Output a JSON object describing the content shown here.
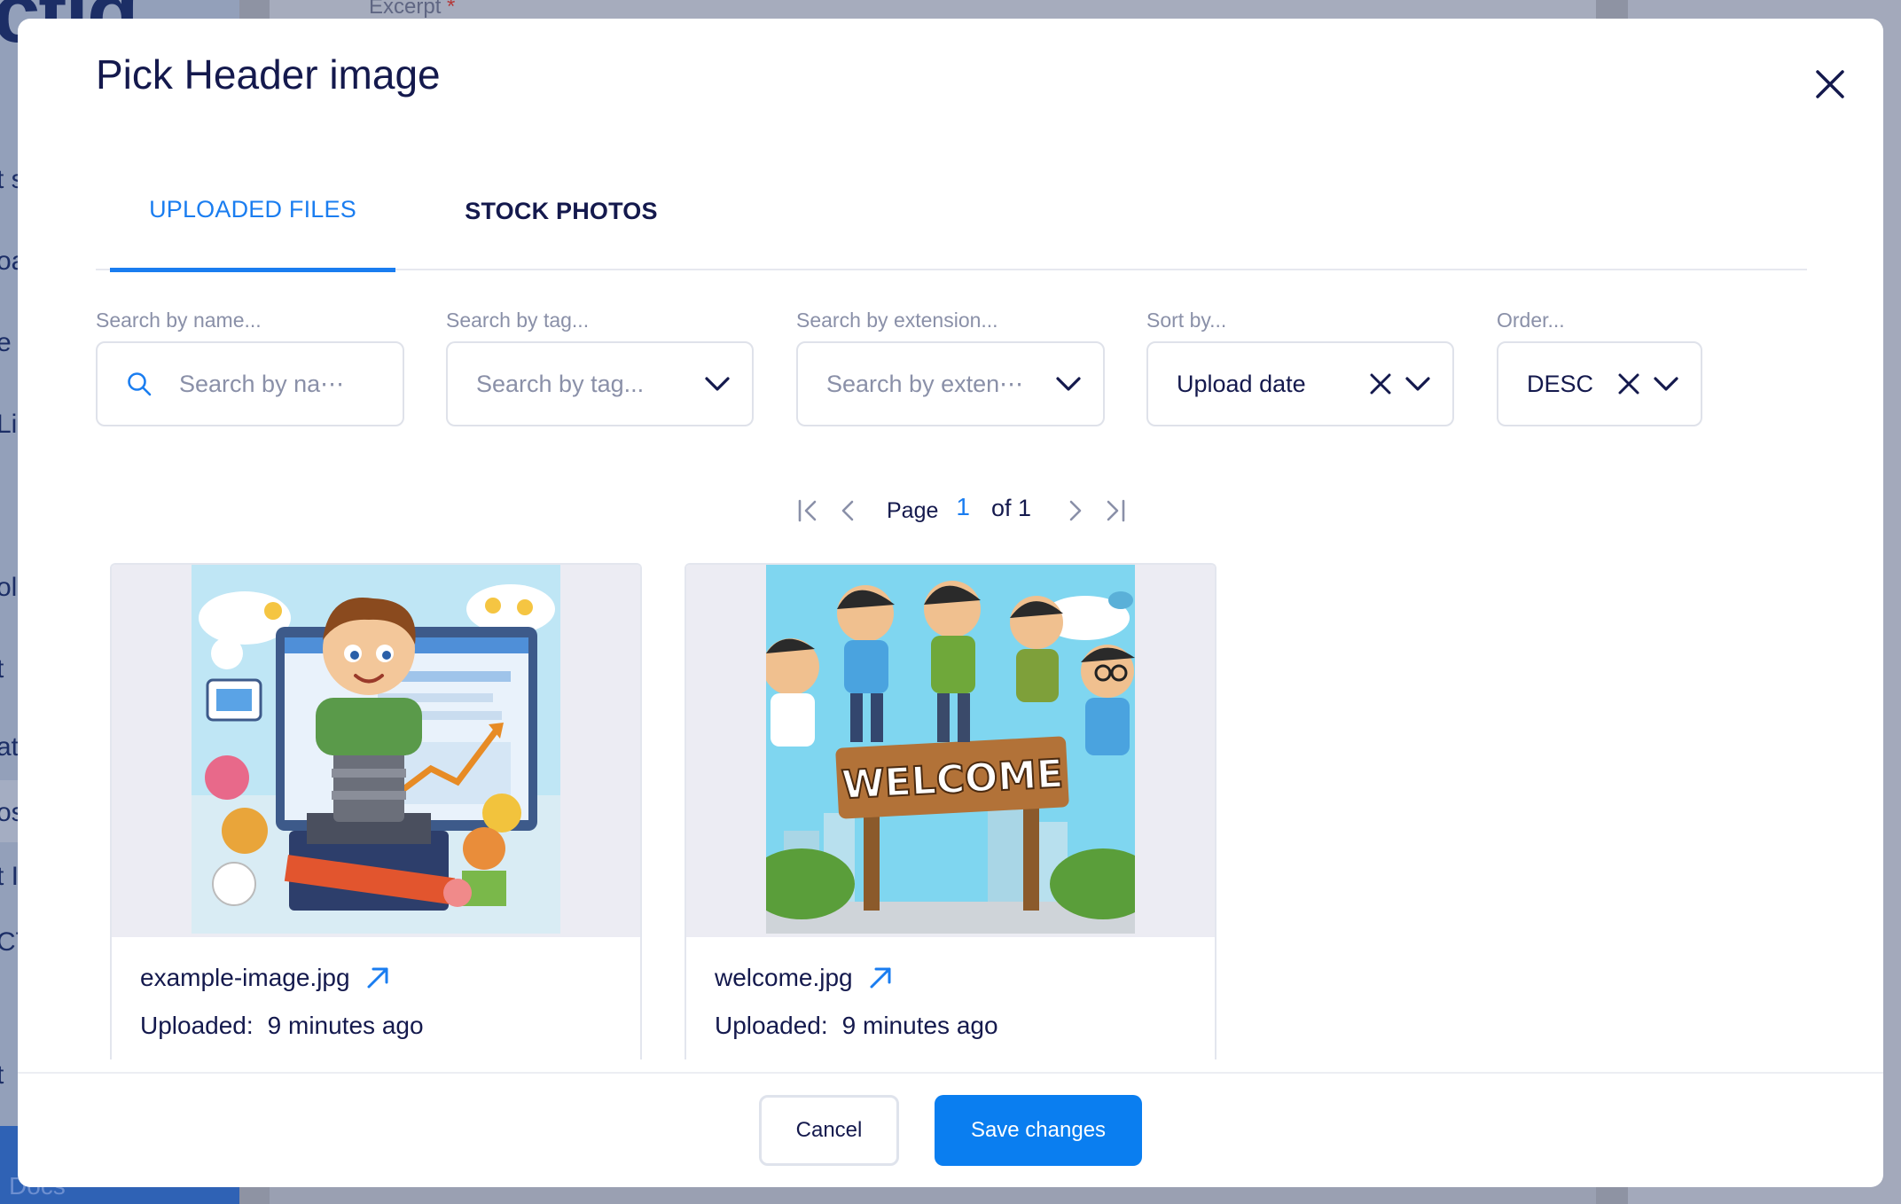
{
  "background": {
    "brand": "ctiq",
    "excerpt_label": "Excerpt",
    "required_mark": "*",
    "sidebar_fragments": [
      "t s",
      "oa",
      "e",
      "Li",
      "ole",
      "t",
      "ate",
      "os",
      "t I",
      "CT",
      "t"
    ],
    "docs_label": "Docs"
  },
  "modal": {
    "title": "Pick Header image",
    "tabs": [
      {
        "label": "UPLOADED FILES",
        "active": true
      },
      {
        "label": "STOCK PHOTOS",
        "active": false
      }
    ],
    "filters": {
      "name": {
        "label": "Search by name...",
        "placeholder": "Search by na⋯"
      },
      "tag": {
        "label": "Search by tag...",
        "placeholder": "Search by tag..."
      },
      "extension": {
        "label": "Search by extension...",
        "placeholder": "Search by exten⋯"
      },
      "sort": {
        "label": "Sort by...",
        "value": "Upload date"
      },
      "order": {
        "label": "Order...",
        "value": "DESC"
      }
    },
    "pagination": {
      "page_label": "Page",
      "current": "1",
      "of_label": "of 1"
    },
    "files": [
      {
        "name": "example-image.jpg",
        "uploaded_label": "Uploaded:",
        "uploaded_value": "9 minutes ago"
      },
      {
        "name": "welcome.jpg",
        "uploaded_label": "Uploaded:",
        "uploaded_value": "9 minutes ago",
        "sign_text": "WELCOME"
      }
    ],
    "footer": {
      "cancel": "Cancel",
      "save": "Save changes"
    },
    "colors": {
      "accent": "#1a7df0",
      "primary_button": "#0a7ef0",
      "text": "#14194d",
      "muted": "#8a90a8"
    }
  }
}
